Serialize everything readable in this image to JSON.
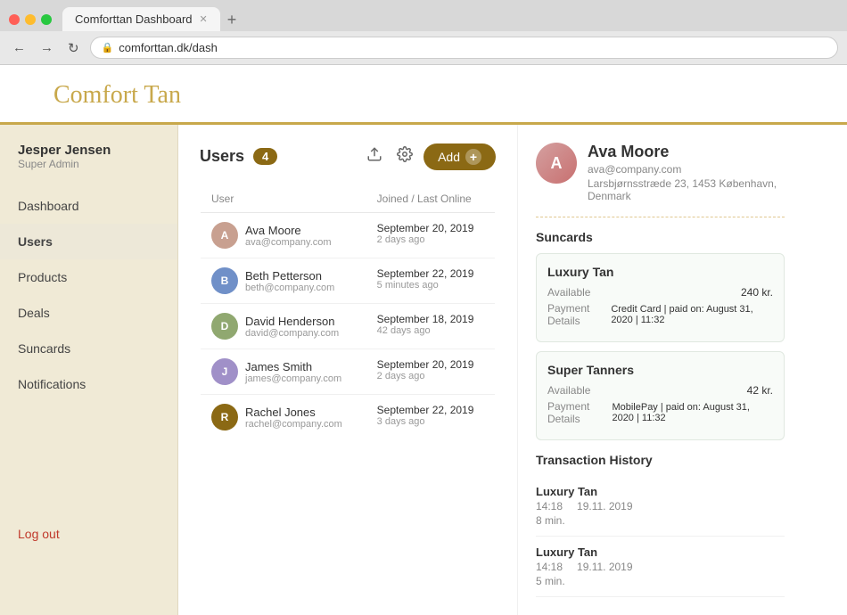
{
  "browser": {
    "tab_title": "Comforttan Dashboard",
    "url": "comforttan.dk/dash",
    "new_tab_label": "+"
  },
  "app": {
    "title": "Comfort Tan"
  },
  "sidebar": {
    "user_name": "Jesper Jensen",
    "user_role": "Super Admin",
    "nav_items": [
      {
        "id": "dashboard",
        "label": "Dashboard"
      },
      {
        "id": "users",
        "label": "Users",
        "active": true
      },
      {
        "id": "products",
        "label": "Products"
      },
      {
        "id": "deals",
        "label": "Deals"
      },
      {
        "id": "suncards",
        "label": "Suncards"
      },
      {
        "id": "notifications",
        "label": "Notifications"
      }
    ],
    "logout_label": "Log out"
  },
  "users_panel": {
    "title": "Users",
    "count": "4",
    "add_label": "Add",
    "col_user": "User",
    "col_joined": "Joined / Last Online",
    "users": [
      {
        "name": "Ava Moore",
        "email": "ava@company.com",
        "joined": "September 20, 2019",
        "last_online": "2 days ago",
        "avatar_initial": "A",
        "avatar_class": "avatar-ava"
      },
      {
        "name": "Beth Petterson",
        "email": "beth@company.com",
        "joined": "September 22, 2019",
        "last_online": "5 minutes ago",
        "avatar_initial": "B",
        "avatar_class": "avatar-beth"
      },
      {
        "name": "David Henderson",
        "email": "david@company.com",
        "joined": "September 18, 2019",
        "last_online": "42 days ago",
        "avatar_initial": "D",
        "avatar_class": "avatar-david"
      },
      {
        "name": "James Smith",
        "email": "james@company.com",
        "joined": "September 20, 2019",
        "last_online": "2 days ago",
        "avatar_initial": "J",
        "avatar_class": "avatar-james"
      },
      {
        "name": "Rachel Jones",
        "email": "rachel@company.com",
        "joined": "September 22, 2019",
        "last_online": "3 days ago",
        "avatar_initial": "R",
        "avatar_class": "avatar-rachel"
      }
    ]
  },
  "profile": {
    "name": "Ava Moore",
    "email": "ava@company.com",
    "address": "Larsbjørnsstræde 23, 1453 København, Denmark",
    "avatar_initial": "A",
    "suncards_title": "Suncards",
    "suncards": [
      {
        "name": "Luxury Tan",
        "available_label": "Available",
        "available_value": "240 kr.",
        "payment_label": "Payment Details",
        "payment_value": "Credit Card | paid on: August 31, 2020 | 11:32"
      },
      {
        "name": "Super Tanners",
        "available_label": "Available",
        "available_value": "42 kr.",
        "payment_label": "Payment Details",
        "payment_value": "MobilePay | paid on: August 31, 2020 | 11:32"
      }
    ],
    "transaction_title": "Transaction History",
    "transactions": [
      {
        "name": "Luxury Tan",
        "time": "14:18",
        "date": "19.11. 2019",
        "duration": "8 min."
      },
      {
        "name": "Luxury Tan",
        "time": "14:18",
        "date": "19.11. 2019",
        "duration": "5 min."
      }
    ]
  }
}
